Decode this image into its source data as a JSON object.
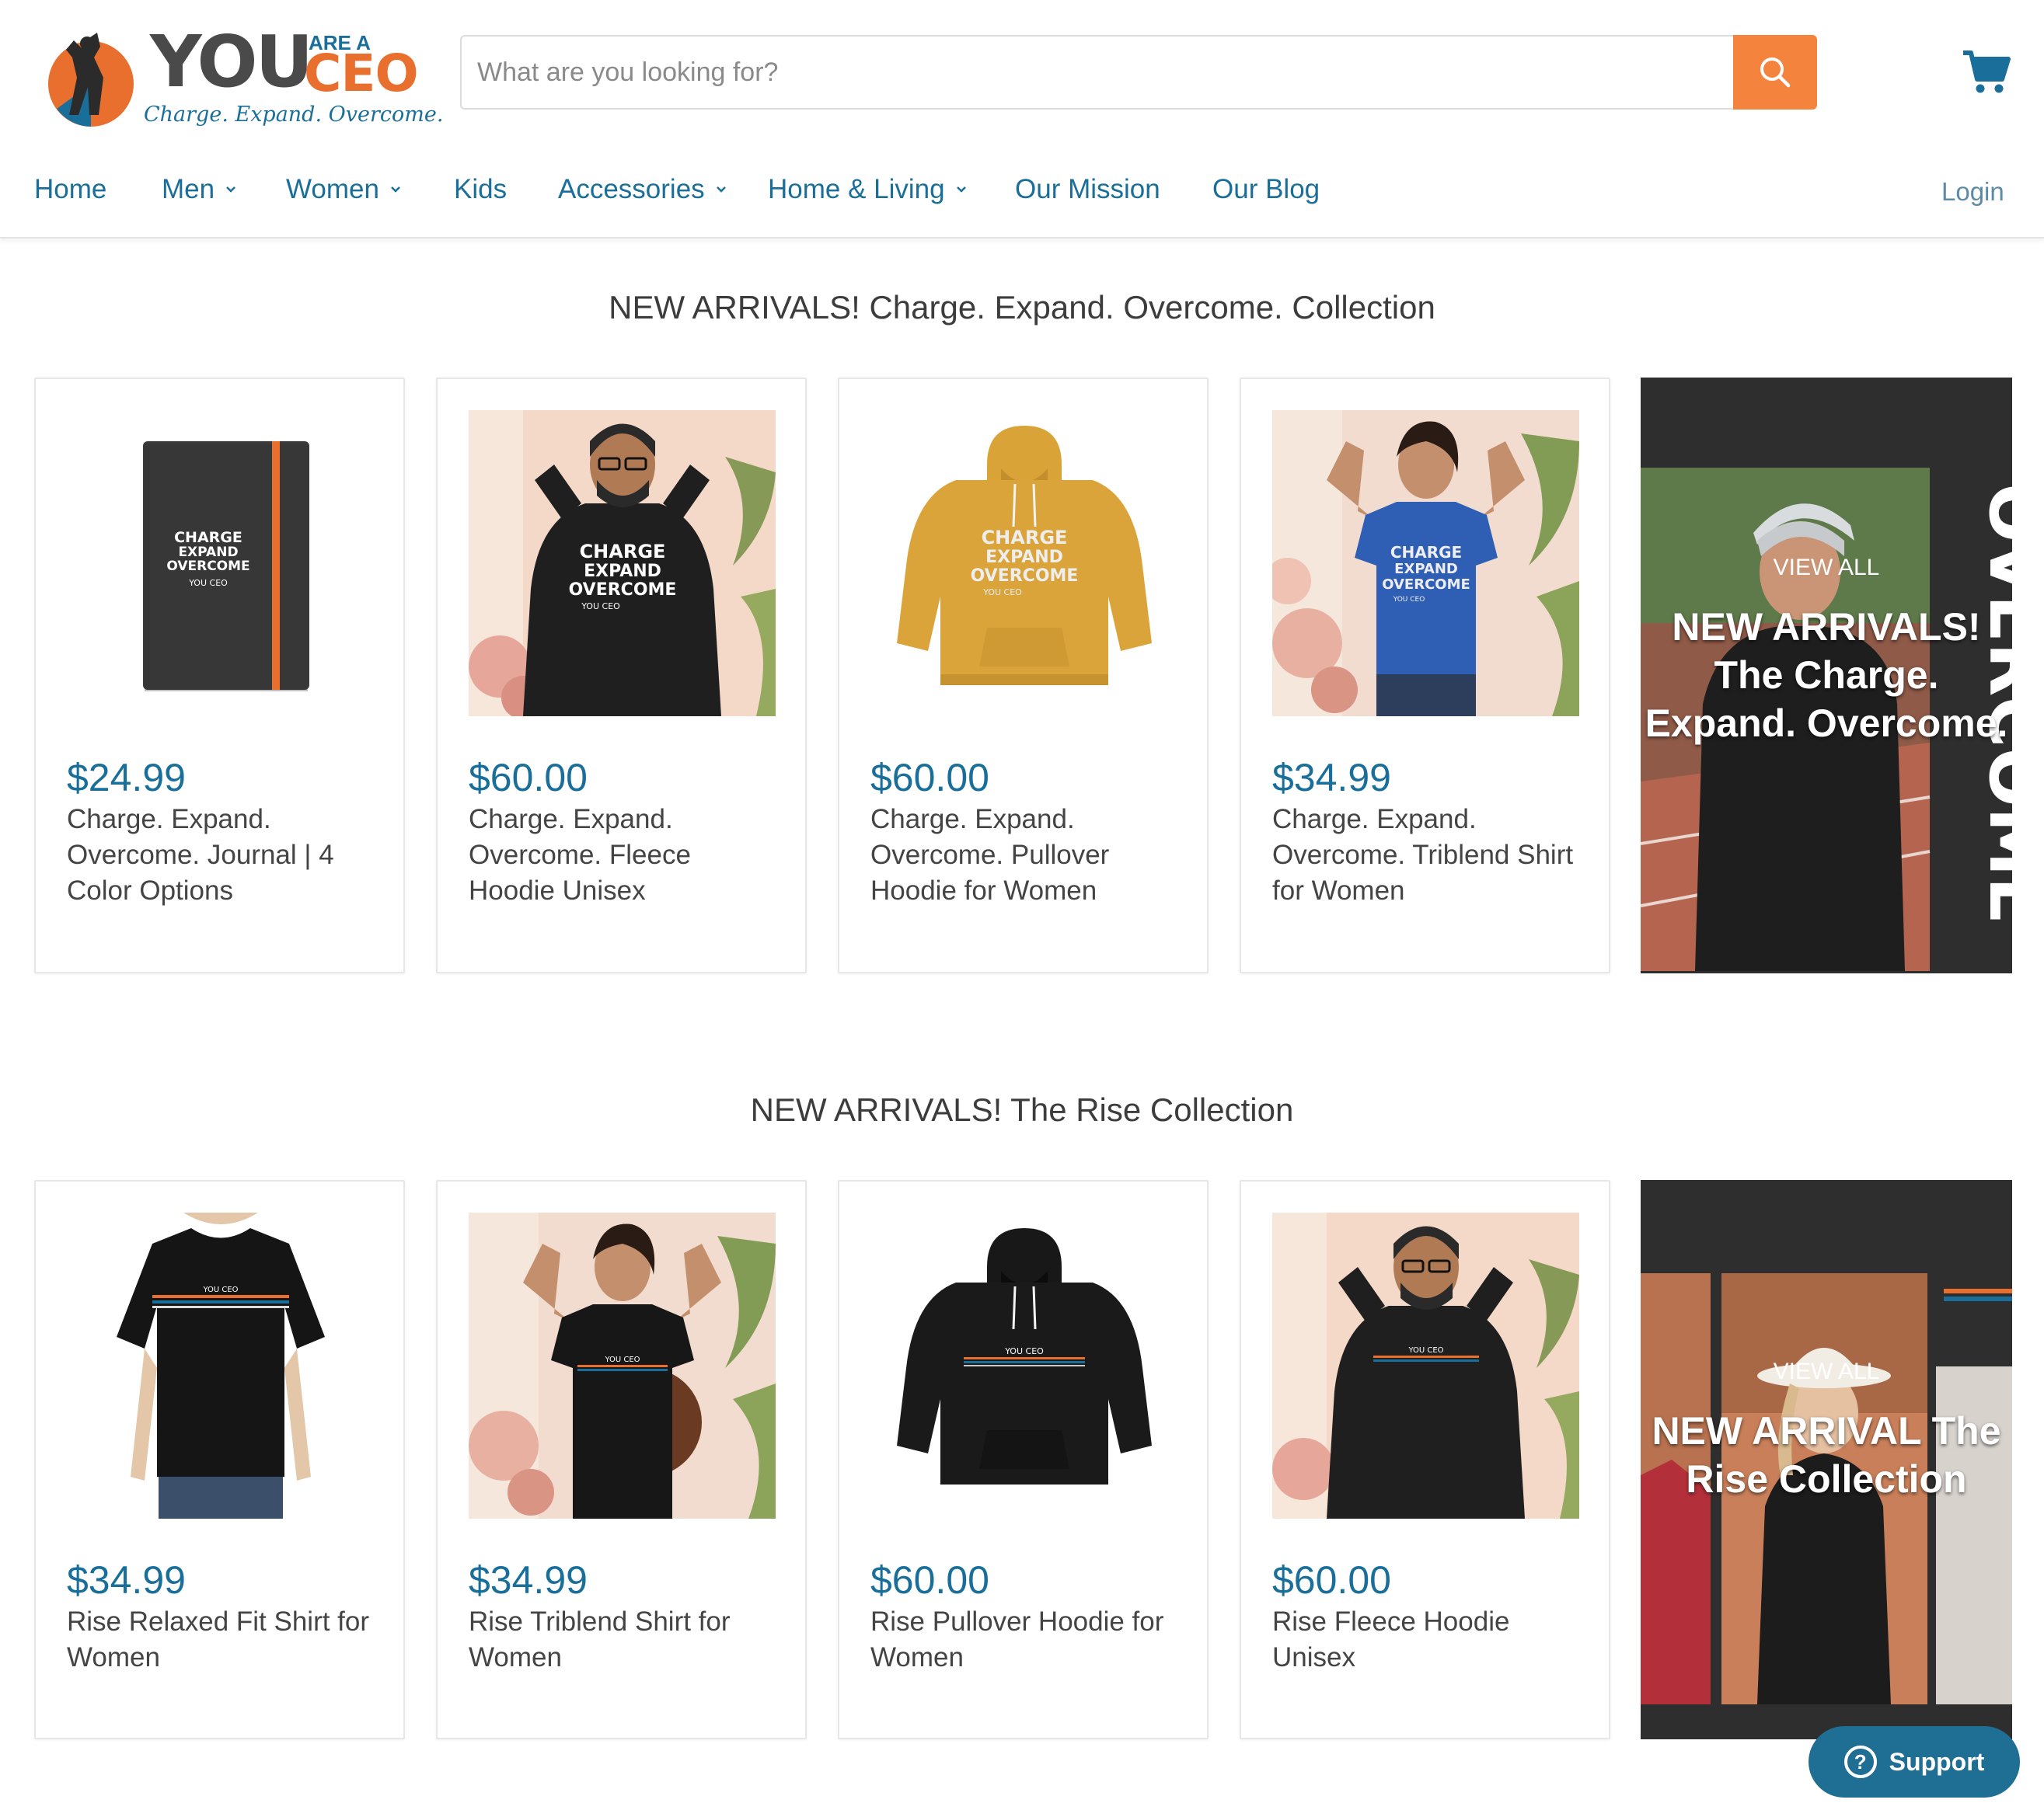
{
  "header": {
    "logo": {
      "you": "YOU",
      "are_a": "ARE A",
      "ceo": "CEO",
      "tagline": "Charge. Expand. Overcome."
    },
    "search": {
      "placeholder": "What are you looking for?",
      "icon": "search-icon"
    },
    "cart_icon": "cart-icon",
    "nav": [
      {
        "label": "Home",
        "has_dropdown": false
      },
      {
        "label": "Men",
        "has_dropdown": true
      },
      {
        "label": "Women",
        "has_dropdown": true
      },
      {
        "label": "Kids",
        "has_dropdown": false
      },
      {
        "label": "Accessories",
        "has_dropdown": true
      },
      {
        "label": "Home & Living",
        "has_dropdown": true
      },
      {
        "label": "Our Mission",
        "has_dropdown": false
      },
      {
        "label": "Our Blog",
        "has_dropdown": false
      }
    ],
    "login": "Login"
  },
  "sections": [
    {
      "title": "NEW ARRIVALS! Charge. Expand. Overcome. Collection",
      "products": [
        {
          "price": "$24.99",
          "title": "Charge. Expand. Overcome. Journal | 4 Color Options",
          "image": "journal"
        },
        {
          "price": "$60.00",
          "title": "Charge. Expand. Overcome. Fleece Hoodie Unisex",
          "image": "man-black-hoodie"
        },
        {
          "price": "$60.00",
          "title": "Charge. Expand. Overcome. Pullover Hoodie for Women",
          "image": "mustard-hoodie"
        },
        {
          "price": "$34.99",
          "title": "Charge. Expand. Overcome. Triblend Shirt for Women",
          "image": "woman-blue-shirt"
        }
      ],
      "promo": {
        "view_all": "VIEW ALL",
        "headline": "NEW ARRIVALS! The Charge. Expand. Overcome."
      }
    },
    {
      "title": "NEW ARRIVALS! The Rise Collection",
      "products": [
        {
          "price": "$34.99",
          "title": "Rise Relaxed Fit Shirt for Women",
          "image": "woman-black-tee"
        },
        {
          "price": "$34.99",
          "title": "Rise Triblend Shirt for Women",
          "image": "woman-black-shirt"
        },
        {
          "price": "$60.00",
          "title": "Rise Pullover Hoodie for Women",
          "image": "black-hoodie"
        },
        {
          "price": "$60.00",
          "title": "Rise Fleece Hoodie Unisex",
          "image": "man-black-hoodie-rise"
        }
      ],
      "promo": {
        "view_all": "VIEW ALL",
        "headline": "NEW ARRIVAL The Rise Collection"
      }
    }
  ],
  "product_print": {
    "line1": "CHARGE",
    "line2": "EXPAND",
    "line3": "OVERCOME",
    "brand": "YOU CEO"
  },
  "support": {
    "label": "Support"
  },
  "colors": {
    "brand_blue": "#1a6f9a",
    "brand_orange": "#f4833d",
    "promo_bg": "#2e2e2e"
  }
}
